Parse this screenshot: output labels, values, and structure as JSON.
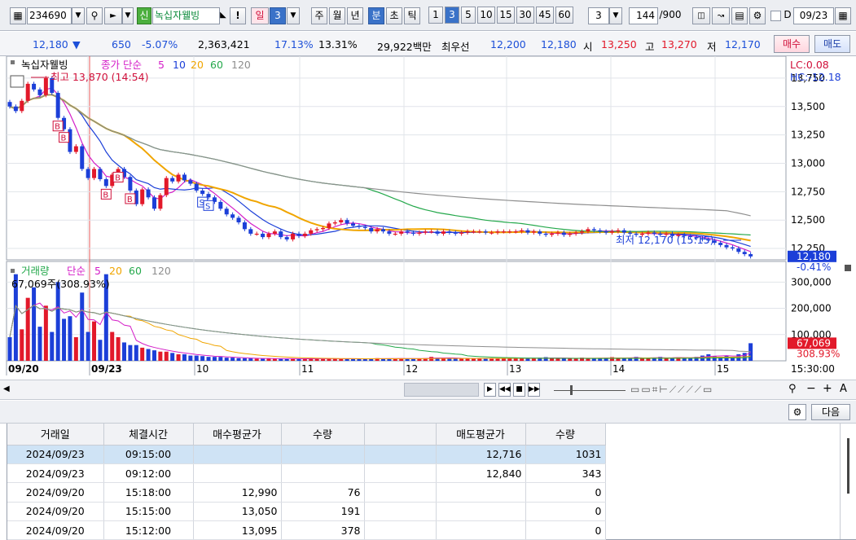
{
  "toolbar": {
    "code": "234690",
    "badge": "신",
    "name": "녹십자웰빙",
    "excl": "!",
    "period_day": "일",
    "period_day_n": "3",
    "week": "주",
    "month": "월",
    "year": "년",
    "minute": "분",
    "second": "초",
    "tick": "틱",
    "intervals": [
      "1",
      "3",
      "5",
      "10",
      "15",
      "30",
      "45",
      "60"
    ],
    "selected_interval": "3",
    "interval_input": "3",
    "count": "144",
    "count_max": "/900",
    "date_check": "D",
    "date": "09/23"
  },
  "quote": {
    "price": "12,180",
    "arrow": "▼",
    "change": "650",
    "change_pct": "-5.07%",
    "volume": "2,363,421",
    "pct1": "17.13%",
    "pct2": "13.31%",
    "amount": "29,922백만",
    "best_label": "최우선",
    "ask": "12,200",
    "bid": "12,180",
    "open_label": "시",
    "open": "13,250",
    "high_label": "고",
    "high": "13,270",
    "low_label": "저",
    "low": "12,170",
    "buy": "매수",
    "sell": "매도"
  },
  "price_panel": {
    "title": "녹십자웰빙",
    "ma_label": "종가 단순",
    "ma": [
      "5",
      "10",
      "20",
      "60",
      "120"
    ],
    "high_note": "최고 13,870 (14:54)",
    "low_note": "최저 12,170 (15:15)",
    "lc": "LC:0.08",
    "hc": "HC:-12.18",
    "ticks": [
      "13,750",
      "13,500",
      "13,250",
      "13,000",
      "12,750",
      "12,500",
      "12,250"
    ],
    "last": "12,180",
    "last_pct": "-0.41%"
  },
  "vol_panel": {
    "title": "거래량",
    "ma_label": "단순",
    "ma": [
      "5",
      "20",
      "60",
      "120"
    ],
    "current": "67,069주(308.93%)",
    "ticks": [
      "300,000",
      "200,000",
      "100,000"
    ],
    "last": "67,069",
    "last_pct": "308.93%"
  },
  "xaxis": [
    "09/20",
    "09/23",
    "10",
    "11",
    "12",
    "13",
    "14",
    "15"
  ],
  "clock": "15:30:00",
  "chart_data": {
    "type": "candlestick",
    "last_price": 12180,
    "day_high": 13870,
    "day_low": 12170,
    "ylim": [
      12150,
      13900
    ],
    "vol_ylim": [
      0,
      360000
    ],
    "close": [
      13500,
      13460,
      13550,
      13700,
      13650,
      13600,
      13750,
      13620,
      13400,
      13300,
      13100,
      13150,
      12950,
      12870,
      12950,
      12860,
      12800,
      12900,
      12950,
      12880,
      12760,
      12640,
      12770,
      12700,
      12600,
      12720,
      12870,
      12840,
      12900,
      12850,
      12820,
      12760,
      12730,
      12700,
      12660,
      12600,
      12550,
      12520,
      12480,
      12420,
      12380,
      12380,
      12350,
      12380,
      12400,
      12350,
      12330,
      12380,
      12360,
      12380,
      12410,
      12420,
      12430,
      12470,
      12480,
      12500,
      12470,
      12450,
      12440,
      12430,
      12400,
      12420,
      12400,
      12380,
      12380,
      12400,
      12390,
      12380,
      12390,
      12400,
      12400,
      12380,
      12400,
      12390,
      12380,
      12390,
      12400,
      12400,
      12400,
      12390,
      12390,
      12400,
      12400,
      12400,
      12400,
      12410,
      12390,
      12400,
      12380,
      12370,
      12380,
      12390,
      12370,
      12380,
      12390,
      12400,
      12420,
      12410,
      12400,
      12390,
      12400,
      12410,
      12390,
      12380,
      12370,
      12380,
      12390,
      12380,
      12370,
      12380,
      12360,
      12370,
      12360,
      12350,
      12340,
      12330,
      12320,
      12300,
      12280,
      12260,
      12250,
      12220,
      12200,
      12180
    ],
    "volume": [
      90000,
      330000,
      120000,
      240000,
      280000,
      130000,
      210000,
      110000,
      300000,
      160000,
      170000,
      90000,
      260000,
      110000,
      150000,
      80000,
      330000,
      110000,
      90000,
      70000,
      60000,
      60000,
      50000,
      45000,
      40000,
      35000,
      35000,
      30000,
      25000,
      25000,
      20000,
      20000,
      18000,
      15000,
      15000,
      15000,
      12000,
      12000,
      10000,
      10000,
      9000,
      8000,
      8000,
      9000,
      8000,
      8000,
      7000,
      8000,
      7000,
      8000,
      9000,
      8000,
      7000,
      9000,
      8000,
      7000,
      8000,
      8000,
      7000,
      7000,
      8000,
      10000,
      9000,
      8000,
      8000,
      9000,
      8000,
      9000,
      8000,
      10000,
      15000,
      12000,
      10000,
      9000,
      8000,
      9000,
      10000,
      8000,
      9000,
      10000,
      8000,
      9000,
      10000,
      12000,
      9000,
      8000,
      9000,
      10000,
      12000,
      14000,
      10000,
      9000,
      10000,
      8000,
      9000,
      12000,
      10000,
      9000,
      10000,
      12000,
      14000,
      10000,
      9000,
      12000,
      15000,
      10000,
      9000,
      12000,
      15000,
      10000,
      12000,
      14000,
      10000,
      12000,
      15000,
      20000,
      25000,
      18000,
      15000,
      20000,
      14000,
      25000,
      30000,
      67069
    ]
  }
}
